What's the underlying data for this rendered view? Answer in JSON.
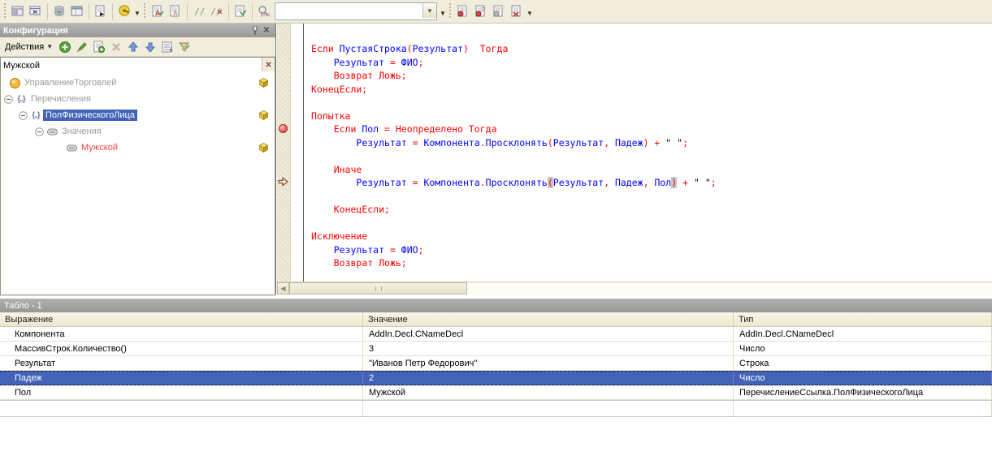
{
  "colors": {
    "selection_blue": "#4263b8",
    "keyword_red": "#ff0000",
    "identifier_blue": "#0000ff",
    "search_match_red": "#ff4242",
    "breakpoint_red": "#e85050",
    "locked_cube_yellow": "#e8c030",
    "toolbar_beige": "#f0eddc"
  },
  "toolbar": {
    "items": [
      {
        "t": "grip"
      },
      {
        "t": "i",
        "n": "edit-form-icon"
      },
      {
        "t": "i",
        "n": "close-windows-icon"
      },
      {
        "t": "sep"
      },
      {
        "t": "i",
        "n": "update-db-config-icon"
      },
      {
        "t": "i",
        "n": "form-table-icon"
      },
      {
        "t": "sep"
      },
      {
        "t": "i",
        "n": "open-module-icon"
      },
      {
        "t": "sep"
      },
      {
        "t": "i",
        "n": "save-image-icon"
      },
      {
        "t": "dd"
      },
      {
        "t": "grip"
      },
      {
        "t": "i",
        "n": "syntax-check-icon"
      },
      {
        "t": "i",
        "n": "syntax-check-all-icon"
      },
      {
        "t": "sep"
      },
      {
        "t": "i",
        "n": "add-comment-icon"
      },
      {
        "t": "i",
        "n": "remove-comment-icon"
      },
      {
        "t": "sep"
      },
      {
        "t": "i",
        "n": "format-module-icon"
      },
      {
        "t": "sep"
      },
      {
        "t": "i",
        "n": "procedures-functions-icon"
      },
      {
        "t": "combo"
      },
      {
        "t": "dd"
      },
      {
        "t": "grip"
      },
      {
        "t": "i",
        "n": "breakpoint-icon"
      },
      {
        "t": "i",
        "n": "conditional-breakpoint-icon"
      },
      {
        "t": "i",
        "n": "disable-breakpoint-icon"
      },
      {
        "t": "i",
        "n": "remove-all-breakpoints-icon"
      },
      {
        "t": "dd"
      }
    ],
    "procedure_combo_value": ""
  },
  "config_panel": {
    "title": "Конфигурация",
    "pin_icon": "pin-icon",
    "close_icon": "close-icon",
    "actions": {
      "label": "Действия",
      "icons": [
        "add-icon",
        "edit-icon",
        "copy-add-icon",
        "delete-icon",
        "move-up-icon",
        "move-down-icon",
        "list-icon",
        "filter-icon"
      ]
    },
    "search_value": "Мужской",
    "tree": [
      {
        "label": "УправлениеТорговлей",
        "icon": "config-root-icon",
        "indent": 8,
        "expander": false,
        "dim": true,
        "locked": true
      },
      {
        "label": "Перечисления",
        "icon": "braces-icon",
        "indent": 2,
        "expander": true,
        "dim": true,
        "locked": false
      },
      {
        "label": "ПолФизическогоЛица",
        "icon": "braces-icon",
        "indent": 20,
        "expander": true,
        "selected": true,
        "locked": true
      },
      {
        "label": "Значения",
        "icon": "enum-values-icon",
        "indent": 40,
        "expander": true,
        "dim": true,
        "locked": false
      },
      {
        "label": "Мужской",
        "icon": "enum-value-icon",
        "indent": 78,
        "expander": false,
        "match": true,
        "locked": true
      }
    ]
  },
  "editor": {
    "breakpoint_line": 6,
    "current_line": 10,
    "lines": [
      [
        [
          "k",
          "Если "
        ],
        [
          "i",
          "ПустаяСтрока"
        ],
        [
          "k",
          "("
        ],
        [
          "i",
          "Результат"
        ],
        [
          "k",
          ")  "
        ],
        [
          "k",
          "Тогда"
        ]
      ],
      [
        [
          "p",
          "    "
        ],
        [
          "i",
          "Результат"
        ],
        [
          "k",
          " = "
        ],
        [
          "i",
          "ФИО"
        ],
        [
          "k",
          ";"
        ]
      ],
      [
        [
          "p",
          "    "
        ],
        [
          "k",
          "Возврат Ложь;"
        ]
      ],
      [
        [
          "k",
          "КонецЕсли;"
        ]
      ],
      [],
      [
        [
          "k",
          "Попытка"
        ]
      ],
      [
        [
          "p",
          "    "
        ],
        [
          "k",
          "Если "
        ],
        [
          "i",
          "Пол"
        ],
        [
          "k",
          " = Неопределено Тогда"
        ]
      ],
      [
        [
          "p",
          "        "
        ],
        [
          "i",
          "Результат"
        ],
        [
          "k",
          " = "
        ],
        [
          "i",
          "Компонента"
        ],
        [
          "k",
          "."
        ],
        [
          "i",
          "Просклонять"
        ],
        [
          "k",
          "("
        ],
        [
          "i",
          "Результат"
        ],
        [
          "k",
          ", "
        ],
        [
          "i",
          "Падеж"
        ],
        [
          "k",
          ") + "
        ],
        [
          "s",
          "\" \""
        ],
        [
          "k",
          ";"
        ]
      ],
      [],
      [
        [
          "p",
          "    "
        ],
        [
          "k",
          "Иначе"
        ]
      ],
      [
        [
          "p",
          "        "
        ],
        [
          "i",
          "Результат"
        ],
        [
          "k",
          " = "
        ],
        [
          "i",
          "Компонента"
        ],
        [
          "k",
          "."
        ],
        [
          "i",
          "Просклонять"
        ],
        [
          "hb",
          "("
        ],
        [
          "i",
          "Результат"
        ],
        [
          "k",
          ", "
        ],
        [
          "i",
          "Падеж"
        ],
        [
          "k",
          ", "
        ],
        [
          "i",
          "Пол"
        ],
        [
          "hb",
          ")"
        ],
        [
          "k",
          " + "
        ],
        [
          "s",
          "\" \""
        ],
        [
          "k",
          ";"
        ]
      ],
      [],
      [
        [
          "p",
          "    "
        ],
        [
          "k",
          "КонецЕсли;"
        ]
      ],
      [],
      [
        [
          "k",
          "Исключение"
        ]
      ],
      [
        [
          "p",
          "    "
        ],
        [
          "i",
          "Результат"
        ],
        [
          "k",
          " = "
        ],
        [
          "i",
          "ФИО"
        ],
        [
          "k",
          ";"
        ]
      ],
      [
        [
          "p",
          "    "
        ],
        [
          "k",
          "Возврат Ложь;"
        ]
      ]
    ]
  },
  "tablo": {
    "title": "Табло - 1",
    "columns": [
      "Выражение",
      "Значение",
      "Тип"
    ],
    "rows": [
      {
        "expr": "Компонента",
        "value": "AddIn.Decl.CNameDecl",
        "type": "AddIn.Decl.CNameDecl",
        "selected": false
      },
      {
        "expr": "МассивСтрок.Количество()",
        "value": "3",
        "type": "Число",
        "selected": false
      },
      {
        "expr": "Результат",
        "value": "\"Иванов Петр Федорович\"",
        "type": "Строка",
        "selected": false
      },
      {
        "expr": "Падеж",
        "value": "2",
        "type": "Число",
        "selected": true
      },
      {
        "expr": "Пол",
        "value": "Мужской",
        "type": "ПеречислениеСсылка.ПолФизическогоЛица",
        "selected": false
      },
      {
        "expr": "",
        "value": "",
        "type": "",
        "selected": false
      }
    ]
  }
}
